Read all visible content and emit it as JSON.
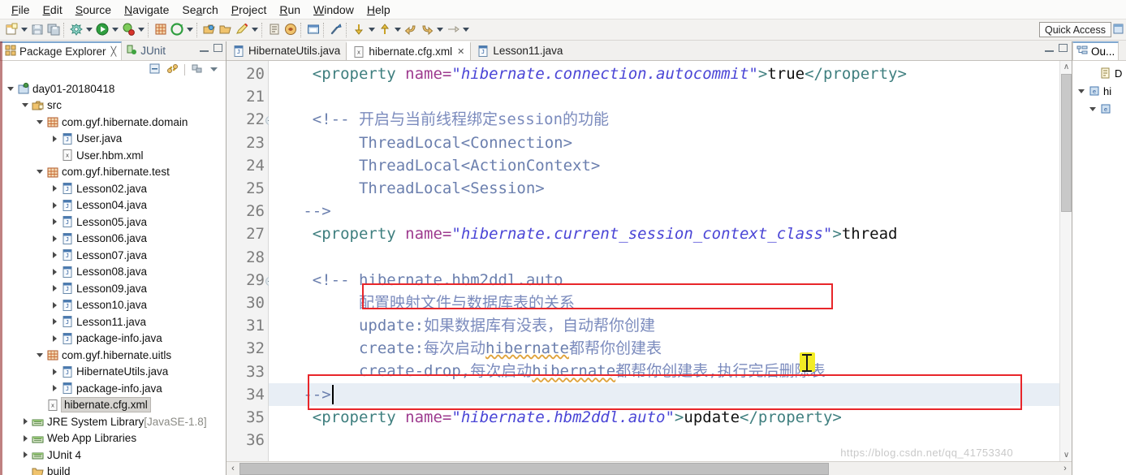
{
  "window": {
    "quick_access": "Quick Access",
    "watermark": "https://blog.csdn.net/qq_41753340"
  },
  "menubar": {
    "items": [
      {
        "label": "File",
        "mnemonic": "F"
      },
      {
        "label": "Edit",
        "mnemonic": "E"
      },
      {
        "label": "Source",
        "mnemonic": "S"
      },
      {
        "label": "Navigate",
        "mnemonic": "N"
      },
      {
        "label": "Search",
        "mnemonic": "a"
      },
      {
        "label": "Project",
        "mnemonic": "P"
      },
      {
        "label": "Run",
        "mnemonic": "R"
      },
      {
        "label": "Window",
        "mnemonic": "W"
      },
      {
        "label": "Help",
        "mnemonic": "H"
      }
    ]
  },
  "toolbar": {
    "items": [
      {
        "name": "new-wizard-icon",
        "kind": "icon"
      },
      {
        "name": "new-wizard-dropdown-icon",
        "kind": "arrow"
      },
      {
        "name": "save-icon",
        "kind": "icon"
      },
      {
        "name": "save-all-icon",
        "kind": "icon"
      },
      {
        "name": "sep-1",
        "kind": "sep"
      },
      {
        "name": "build-icon",
        "kind": "icon"
      },
      {
        "name": "build-dropdown-icon",
        "kind": "arrow"
      },
      {
        "name": "run-icon",
        "kind": "icon"
      },
      {
        "name": "run-dropdown-icon",
        "kind": "arrow"
      },
      {
        "name": "debug-icon",
        "kind": "icon"
      },
      {
        "name": "debug-dropdown-icon",
        "kind": "arrow"
      },
      {
        "name": "sep-2",
        "kind": "sep"
      },
      {
        "name": "new-java-package-icon",
        "kind": "icon"
      },
      {
        "name": "new-java-class-icon",
        "kind": "icon"
      },
      {
        "name": "new-class-dropdown-icon",
        "kind": "arrow"
      },
      {
        "name": "sep-3",
        "kind": "sep"
      },
      {
        "name": "open-type-icon",
        "kind": "icon"
      },
      {
        "name": "open-resource-icon",
        "kind": "icon"
      },
      {
        "name": "edit-icon",
        "kind": "icon"
      },
      {
        "name": "edit-dropdown-icon",
        "kind": "arrow"
      },
      {
        "name": "sep-4",
        "kind": "sep"
      },
      {
        "name": "toggle-breakpoint-icon",
        "kind": "icon"
      },
      {
        "name": "external-tools-icon",
        "kind": "icon"
      },
      {
        "name": "sep-5",
        "kind": "sep"
      },
      {
        "name": "console-icon",
        "kind": "icon"
      },
      {
        "name": "sep-6",
        "kind": "sep"
      },
      {
        "name": "search-icon",
        "kind": "icon"
      },
      {
        "name": "sep-7",
        "kind": "sep"
      },
      {
        "name": "next-annotation-icon",
        "kind": "icon"
      },
      {
        "name": "next-annotation-dropdown-icon",
        "kind": "arrow"
      },
      {
        "name": "previous-annotation-icon",
        "kind": "icon"
      },
      {
        "name": "previous-annotation-dropdown-icon",
        "kind": "arrow"
      },
      {
        "name": "back-icon",
        "kind": "icon"
      },
      {
        "name": "forward-icon",
        "kind": "icon"
      },
      {
        "name": "history-dropdown-icon",
        "kind": "arrow"
      },
      {
        "name": "pin-editor-icon",
        "kind": "icon"
      },
      {
        "name": "pin-dropdown-icon",
        "kind": "arrow"
      }
    ]
  },
  "package_explorer": {
    "tabs": [
      {
        "label": "Package Explorer",
        "icon": "package-explorer-icon",
        "active": true,
        "closeable": true
      },
      {
        "label": "JUnit",
        "icon": "junit-icon",
        "active": false,
        "closeable": false
      }
    ],
    "view_toolbar": [
      {
        "name": "collapse-all-icon"
      },
      {
        "name": "link-with-editor-icon"
      },
      {
        "name": "focus-on-active-task-icon"
      },
      {
        "name": "view-menu-icon"
      }
    ],
    "tree": [
      {
        "indent": 0,
        "twist": "open",
        "icon": "java-project-icon",
        "label": "day01-20180418",
        "dim": "",
        "selected": false
      },
      {
        "indent": 1,
        "twist": "open",
        "icon": "source-folder-icon",
        "label": "src",
        "dim": "",
        "selected": false
      },
      {
        "indent": 2,
        "twist": "open",
        "icon": "package-icon",
        "label": "com.gyf.hibernate.domain",
        "dim": "",
        "selected": false
      },
      {
        "indent": 3,
        "twist": "closed",
        "icon": "java-file-icon",
        "label": "User.java",
        "dim": "",
        "selected": false
      },
      {
        "indent": 3,
        "twist": "none",
        "icon": "xml-file-icon",
        "label": "User.hbm.xml",
        "dim": "",
        "selected": false
      },
      {
        "indent": 2,
        "twist": "open",
        "icon": "package-icon",
        "label": "com.gyf.hibernate.test",
        "dim": "",
        "selected": false
      },
      {
        "indent": 3,
        "twist": "closed",
        "icon": "java-file-icon",
        "label": "Lesson02.java",
        "dim": "",
        "selected": false
      },
      {
        "indent": 3,
        "twist": "closed",
        "icon": "java-file-icon",
        "label": "Lesson04.java",
        "dim": "",
        "selected": false
      },
      {
        "indent": 3,
        "twist": "closed",
        "icon": "java-file-icon",
        "label": "Lesson05.java",
        "dim": "",
        "selected": false
      },
      {
        "indent": 3,
        "twist": "closed",
        "icon": "java-file-icon",
        "label": "Lesson06.java",
        "dim": "",
        "selected": false
      },
      {
        "indent": 3,
        "twist": "closed",
        "icon": "java-file-icon",
        "label": "Lesson07.java",
        "dim": "",
        "selected": false
      },
      {
        "indent": 3,
        "twist": "closed",
        "icon": "java-file-icon",
        "label": "Lesson08.java",
        "dim": "",
        "selected": false
      },
      {
        "indent": 3,
        "twist": "closed",
        "icon": "java-file-icon",
        "label": "Lesson09.java",
        "dim": "",
        "selected": false
      },
      {
        "indent": 3,
        "twist": "closed",
        "icon": "java-file-icon",
        "label": "Lesson10.java",
        "dim": "",
        "selected": false
      },
      {
        "indent": 3,
        "twist": "closed",
        "icon": "java-file-icon",
        "label": "Lesson11.java",
        "dim": "",
        "selected": false
      },
      {
        "indent": 3,
        "twist": "closed",
        "icon": "java-file-icon",
        "label": "package-info.java",
        "dim": "",
        "selected": false
      },
      {
        "indent": 2,
        "twist": "open",
        "icon": "package-icon",
        "label": "com.gyf.hibernate.uitls",
        "dim": "",
        "selected": false
      },
      {
        "indent": 3,
        "twist": "closed",
        "icon": "java-file-icon",
        "label": "HibernateUtils.java",
        "dim": "",
        "selected": false
      },
      {
        "indent": 3,
        "twist": "closed",
        "icon": "java-file-icon",
        "label": "package-info.java",
        "dim": "",
        "selected": false
      },
      {
        "indent": 2,
        "twist": "none",
        "icon": "xml-file-icon",
        "label": "hibernate.cfg.xml",
        "dim": "",
        "selected": true
      },
      {
        "indent": 1,
        "twist": "closed",
        "icon": "library-icon",
        "label": "JRE System Library",
        "dim": "[JavaSE-1.8]",
        "selected": false
      },
      {
        "indent": 1,
        "twist": "closed",
        "icon": "library-icon",
        "label": "Web App Libraries",
        "dim": "",
        "selected": false
      },
      {
        "indent": 1,
        "twist": "closed",
        "icon": "library-icon",
        "label": "JUnit 4",
        "dim": "",
        "selected": false
      },
      {
        "indent": 1,
        "twist": "none",
        "icon": "folder-icon",
        "label": "build",
        "dim": "",
        "selected": false
      }
    ]
  },
  "editor": {
    "tabs": [
      {
        "label": "HibernateUtils.java",
        "icon": "java-file-icon",
        "active": false,
        "closeable": false
      },
      {
        "label": "hibernate.cfg.xml",
        "icon": "xml-file-icon",
        "active": true,
        "closeable": true
      },
      {
        "label": "Lesson11.java",
        "icon": "java-file-icon",
        "active": false,
        "closeable": false
      }
    ],
    "first_line_number": 20,
    "line_numbers": [
      "20",
      "21",
      "22",
      "23",
      "24",
      "25",
      "26",
      "27",
      "28",
      "29",
      "30",
      "31",
      "32",
      "33",
      "34",
      "35",
      "36"
    ],
    "fold_markers": [
      22,
      29
    ],
    "current_line": 34,
    "caret_line": 34,
    "lines": [
      {
        "num": "20",
        "segments": [
          {
            "t": "    ",
            "c": "txt"
          },
          {
            "t": "<property",
            "c": "tag"
          },
          {
            "t": " ",
            "c": "txt"
          },
          {
            "t": "name=",
            "c": "attr"
          },
          {
            "t": "\"hibernate.connection.autocommit\"",
            "c": "str"
          },
          {
            "t": ">",
            "c": "tag"
          },
          {
            "t": "true",
            "c": "txt"
          },
          {
            "t": "</property>",
            "c": "tag"
          }
        ]
      },
      {
        "num": "21",
        "segments": []
      },
      {
        "num": "22",
        "segments": [
          {
            "t": "    ",
            "c": "txt"
          },
          {
            "t": "<!-- ",
            "c": "cmt"
          },
          {
            "t": "开启与当前线程绑定session的功能",
            "c": "cmt-cn"
          }
        ]
      },
      {
        "num": "23",
        "segments": [
          {
            "t": "         ThreadLocal<Connection>",
            "c": "cmt"
          }
        ]
      },
      {
        "num": "24",
        "segments": [
          {
            "t": "         ThreadLocal<ActionContext>",
            "c": "cmt"
          }
        ]
      },
      {
        "num": "25",
        "segments": [
          {
            "t": "         ThreadLocal<Session>",
            "c": "cmt"
          }
        ]
      },
      {
        "num": "26",
        "segments": [
          {
            "t": "   -->",
            "c": "cmt"
          }
        ]
      },
      {
        "num": "27",
        "segments": [
          {
            "t": "    ",
            "c": "txt"
          },
          {
            "t": "<property",
            "c": "tag"
          },
          {
            "t": " ",
            "c": "txt"
          },
          {
            "t": "name=",
            "c": "attr"
          },
          {
            "t": "\"hibernate.current_session_context_class\"",
            "c": "str"
          },
          {
            "t": ">",
            "c": "tag"
          },
          {
            "t": "thread",
            "c": "txt"
          }
        ]
      },
      {
        "num": "28",
        "segments": []
      },
      {
        "num": "29",
        "segments": [
          {
            "t": "    ",
            "c": "txt"
          },
          {
            "t": "<!-- hibernate.hbm2ddl.auto",
            "c": "cmt"
          }
        ]
      },
      {
        "num": "30",
        "segments": [
          {
            "t": "         ",
            "c": "cmt"
          },
          {
            "t": "配置映射文件与数据库表的关系",
            "c": "cmt-cn"
          }
        ]
      },
      {
        "num": "31",
        "segments": [
          {
            "t": "         update:",
            "c": "cmt"
          },
          {
            "t": "如果数据库有没表，自动帮你创建",
            "c": "cmt-cn"
          }
        ]
      },
      {
        "num": "32",
        "segments": [
          {
            "t": "         create:",
            "c": "cmt"
          },
          {
            "t": "每次启动",
            "c": "cmt-cn"
          },
          {
            "t": "hibernate",
            "c": "cmt squig"
          },
          {
            "t": "都帮你创建表",
            "c": "cmt-cn"
          }
        ]
      },
      {
        "num": "33",
        "segments": [
          {
            "t": "         create-drop,",
            "c": "cmt"
          },
          {
            "t": "每次启动",
            "c": "cmt-cn"
          },
          {
            "t": "hibernate",
            "c": "cmt squig"
          },
          {
            "t": "都帮你创建表,执行完后删除表",
            "c": "cmt-cn"
          }
        ]
      },
      {
        "num": "34",
        "segments": [
          {
            "t": "   -->",
            "c": "cmt"
          }
        ]
      },
      {
        "num": "35",
        "segments": [
          {
            "t": "    ",
            "c": "txt"
          },
          {
            "t": "<property",
            "c": "tag"
          },
          {
            "t": " ",
            "c": "txt"
          },
          {
            "t": "name=",
            "c": "attr"
          },
          {
            "t": "\"hibernate.hbm2ddl.auto\"",
            "c": "str"
          },
          {
            "t": ">",
            "c": "tag"
          },
          {
            "t": "update",
            "c": "txt"
          },
          {
            "t": "</property>",
            "c": "tag"
          }
        ]
      },
      {
        "num": "36",
        "segments": []
      }
    ],
    "annotations": [
      {
        "name": "redbox-update-comment",
        "color": "#e8262a",
        "target_line": 31
      },
      {
        "name": "redbox-hbm2ddl-property",
        "color": "#e8262a",
        "target_line": 35
      }
    ],
    "scrollbars": {
      "vertical_up": "∧",
      "vertical_down": "∨",
      "horizontal_left": "‹",
      "horizontal_right": "›"
    }
  },
  "outline": {
    "tab_label": "Ou...",
    "items": [
      {
        "indent": 1,
        "twist": "none",
        "icon": "doctype-icon",
        "label": "D"
      },
      {
        "indent": 0,
        "twist": "open",
        "icon": "element-icon",
        "label": "hi"
      },
      {
        "indent": 1,
        "twist": "open",
        "icon": "element-icon",
        "label": ""
      }
    ]
  },
  "colors": {
    "tag": "#3f7f7f",
    "attribute": "#9e3b8f",
    "string": "#4a45d6",
    "comment": "#6b7fae",
    "annotation_red": "#e8262a",
    "cursor_highlight": "#f2ec25",
    "current_line": "#e8eef5",
    "selection": "#d6d4d0"
  }
}
